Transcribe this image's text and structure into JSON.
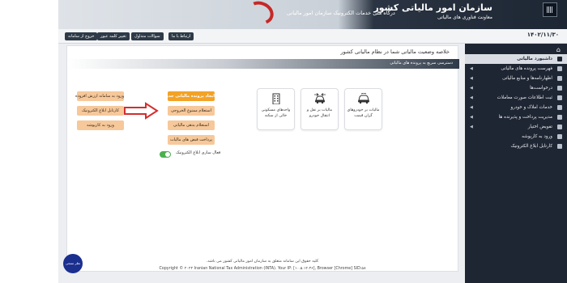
{
  "header": {
    "org_title": "سازمان امور مالیاتی کشور",
    "org_subtitle": "معاونت فناوری های مالیاتی",
    "portal_title": "درگاه ملی خدمات الکترونیک سازمان امور مالیاتی"
  },
  "topbar": {
    "date": "۱۴۰۲/۱۱/۳۰",
    "buttons": [
      "ارتباط با ما",
      "سوالات متداول",
      "تغییر کلمه عبور",
      "خروج از سامانه"
    ]
  },
  "sidebar": {
    "items": [
      {
        "label": "داشبورد مالیاتی",
        "active": true,
        "has_children": false
      },
      {
        "label": "فهرست پرونده های مالیاتی",
        "active": false,
        "has_children": true
      },
      {
        "label": "اظهارنامه‌ها و منابع مالیاتی",
        "active": false,
        "has_children": true
      },
      {
        "label": "درخواست‌ها",
        "active": false,
        "has_children": true
      },
      {
        "label": "ثبت اطلاعات صورت معاملات",
        "active": false,
        "has_children": true
      },
      {
        "label": "خدمات املاک و خودرو",
        "active": false,
        "has_children": true
      },
      {
        "label": "مدیریت پرداخت و پذیرنده ها",
        "active": false,
        "has_children": true
      },
      {
        "label": "تفویض اختیار",
        "active": false,
        "has_children": true
      },
      {
        "label": "ورود به کارپوشه",
        "active": false,
        "has_children": false
      },
      {
        "label": "کارتابل ابلاغ الکترونیک",
        "active": false,
        "has_children": false
      }
    ]
  },
  "main": {
    "title": "خلاصه وضعیت مالیاتی شما در نظام مالیاتی کشور",
    "quickbar": "دسترسی سریع به پرونده های مالیاتی",
    "cards": [
      {
        "label": "مالیات بر خودروهای گران قیمت",
        "icon": "car-icon"
      },
      {
        "label": "مالیات بر نقل و انتقال خودرو",
        "icon": "car-transfer-icon"
      },
      {
        "label": "واحدهای مسکونی خالی از سکنه",
        "icon": "building-icon"
      }
    ],
    "buttons_col1": [
      "ایجاد پرونده مالیاتی جدید",
      "استعلام ممنوع الخروجی",
      "استعلام بدهی مالیاتی",
      "پرداخت قبض های مالیات"
    ],
    "buttons_col2": [
      "ورود به سامانه ارزش افزوده",
      "کارتابل ابلاغ الکترونیک",
      "ورود به کارپوشه"
    ],
    "toggle_label": "فعال سازی ابلاغ الکترونیک",
    "toggle_on": true
  },
  "footer": {
    "line1": "کلیه حقوق این سامانه متعلق به سازمان امور مالیاتی کشور می باشد.",
    "line2": "Copyright © ۲۰۲۴ Iranian National Tax Administration (INTA). Your IP: [۱۰.۵.۱۲.۳۶], Browser [Chrome] SID:۵۸",
    "help": "نظر سنجی"
  },
  "colors": {
    "sidebar_bg": "#1f2633",
    "primary_orange": "#f2a227",
    "light_orange": "#f6c89a",
    "arrow_red": "#d32f2f",
    "toggle_green": "#4caf50"
  }
}
